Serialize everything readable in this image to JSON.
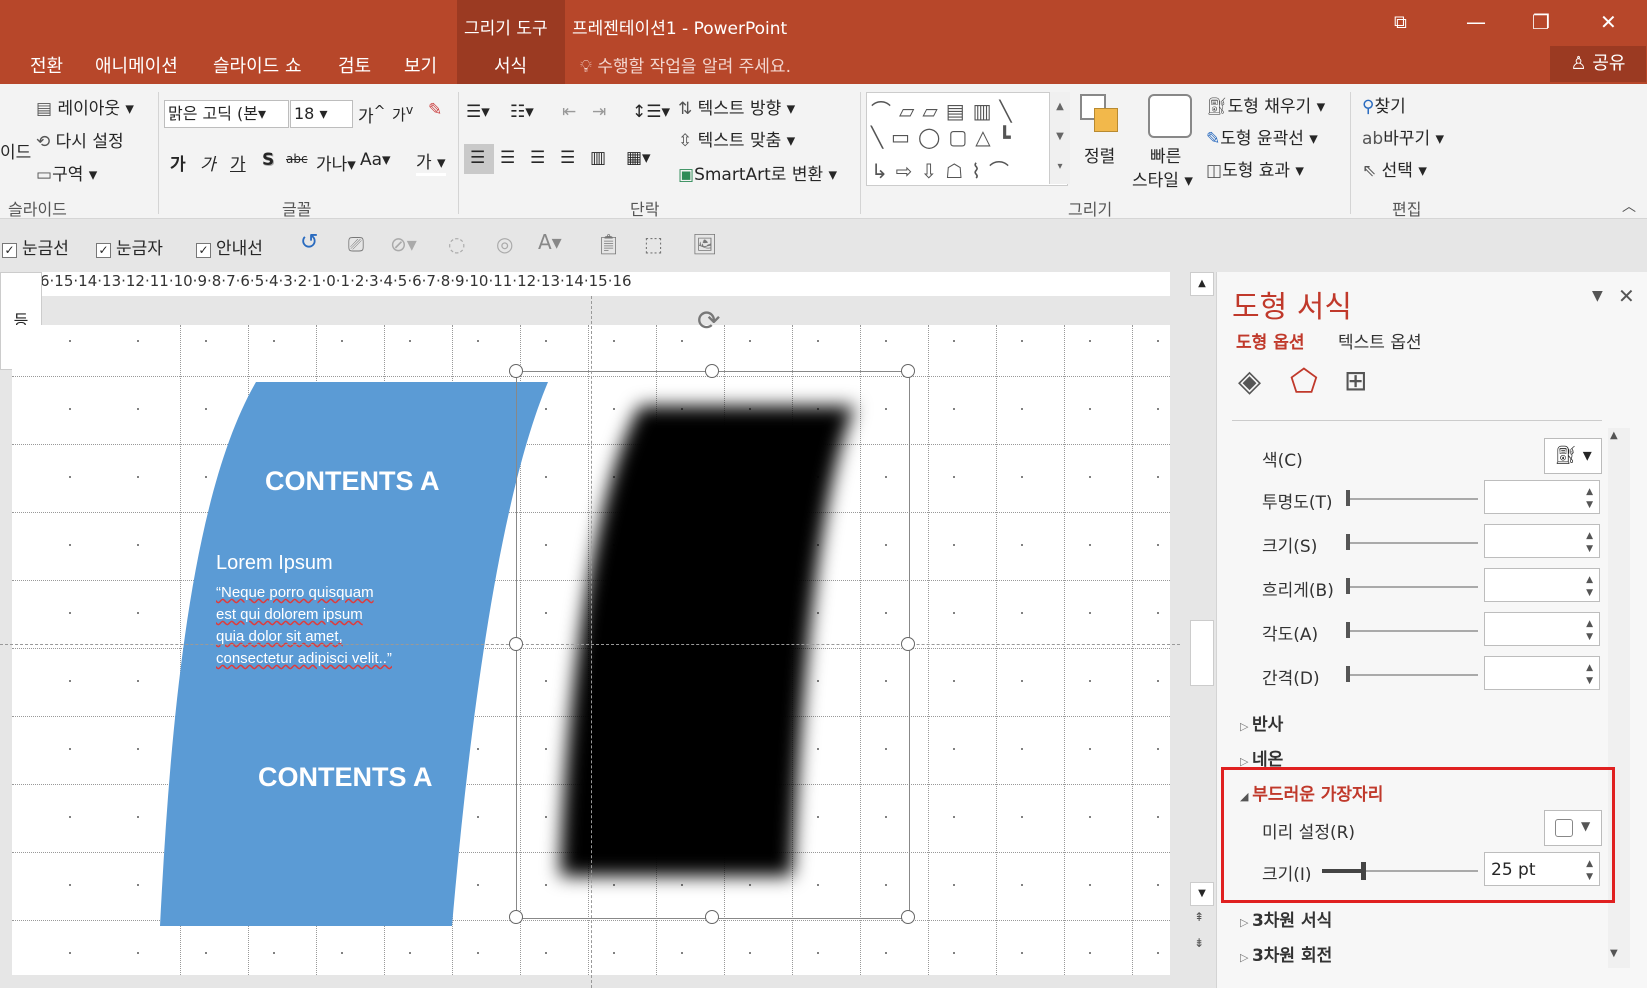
{
  "window": {
    "context_tab": "그리기 도구",
    "title": "프레젠테이션1 - PowerPoint",
    "share": "공유",
    "tell_me": "수행할 작업을 알려 주세요."
  },
  "menu": [
    "전환",
    "애니메이션",
    "슬라이드 쇼",
    "검토",
    "보기",
    "서식"
  ],
  "ribbon": {
    "slides": {
      "label": "슬라이드",
      "layout": "레이아웃",
      "reset": "다시 설정",
      "section": "구역",
      "partial": "이드"
    },
    "font": {
      "label": "글꼴",
      "font_name": "맑은 고딕 (본",
      "font_size": "18",
      "grow": "가",
      "shrink": "가",
      "bold": "가",
      "italic": "가",
      "underline": "가",
      "shadow": "S",
      "strike": "abc",
      "spacing": "가나",
      "case": "Aa",
      "color": "가"
    },
    "paragraph": {
      "label": "단락",
      "text_direction": "텍스트 방향",
      "align_text": "텍스트 맞춤",
      "smartart": "SmartArt로 변환"
    },
    "drawing": {
      "label": "그리기",
      "arrange": "정렬",
      "quick_styles_1": "빠른",
      "quick_styles_2": "스타일",
      "fill": "도형 채우기",
      "outline": "도형 윤곽선",
      "effects": "도형 효과"
    },
    "editing": {
      "label": "편집",
      "find": "찾기",
      "replace": "바꾸기",
      "select": "선택"
    }
  },
  "viewbar": {
    "gridlines": "눈금선",
    "ruler": "눈금자",
    "guides": "안내선"
  },
  "ruler_text": "6·15·14·13·12·11·10·9·8·7·6·5·4·3·2·1·0·1·2·3·4·5·6·7·8·9·10·11·12·13·14·15·16",
  "slide": {
    "side_tab": "등",
    "heading_top": "CONTENTS A",
    "subtitle": "Lorem Ipsum",
    "quote_lines": [
      "“Neque porro quisquam",
      "est qui dolorem ipsum",
      "quia dolor sit amet,",
      "consectetur adipisci velit..”"
    ],
    "heading_bottom": "CONTENTS A"
  },
  "pane": {
    "title": "도형 서식",
    "tab_shape": "도형 옵션",
    "tab_text": "텍스트 옵션",
    "color_label": "색(C)",
    "transparency_label": "투명도(T)",
    "size_label": "크기(S)",
    "blur_label": "흐리게(B)",
    "angle_label": "각도(A)",
    "distance_label": "간격(D)",
    "reflection": "반사",
    "glow": "네온",
    "soft_edges": "부드러운 가장자리",
    "preset_label": "미리 설정(R)",
    "soft_size_label": "크기(I)",
    "soft_size_value": "25 pt",
    "soft_size_fraction": 0.25,
    "format_3d": "3차원 서식",
    "rotation_3d": "3차원 회전"
  },
  "colors": {
    "title_bar": "#b7472a",
    "shape_blue": "#5b9bd5",
    "highlight": "#e02020",
    "accent_text": "#c0392b"
  }
}
